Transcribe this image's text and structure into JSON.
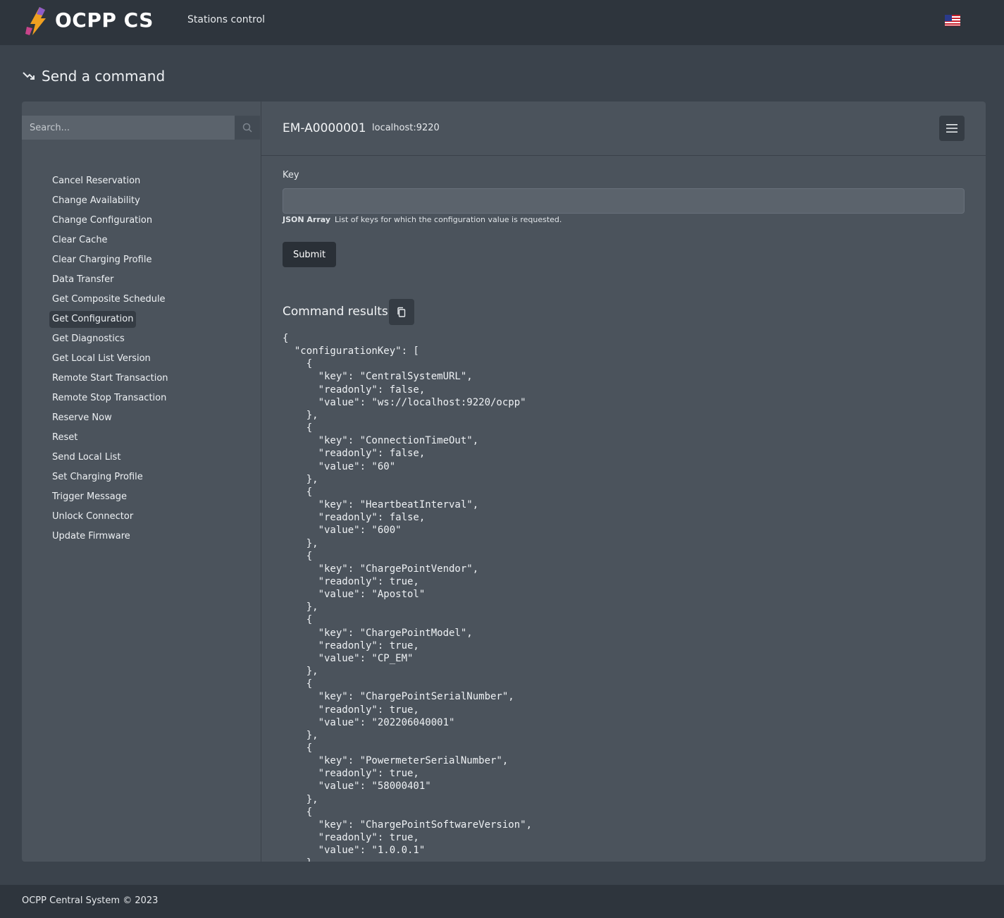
{
  "app": {
    "title": "OCPP CS",
    "nav_link": "Stations control"
  },
  "page": {
    "heading": "Send a command"
  },
  "sidebar": {
    "search_placeholder": "Search...",
    "commands": [
      {
        "label": "Cancel Reservation",
        "active": false
      },
      {
        "label": "Change Availability",
        "active": false
      },
      {
        "label": "Change Configuration",
        "active": false
      },
      {
        "label": "Clear Cache",
        "active": false
      },
      {
        "label": "Clear Charging Profile",
        "active": false
      },
      {
        "label": "Data Transfer",
        "active": false
      },
      {
        "label": "Get Composite Schedule",
        "active": false
      },
      {
        "label": "Get Configuration",
        "active": true
      },
      {
        "label": "Get Diagnostics",
        "active": false
      },
      {
        "label": "Get Local List Version",
        "active": false
      },
      {
        "label": "Remote Start Transaction",
        "active": false
      },
      {
        "label": "Remote Stop Transaction",
        "active": false
      },
      {
        "label": "Reserve Now",
        "active": false
      },
      {
        "label": "Reset",
        "active": false
      },
      {
        "label": "Send Local List",
        "active": false
      },
      {
        "label": "Set Charging Profile",
        "active": false
      },
      {
        "label": "Trigger Message",
        "active": false
      },
      {
        "label": "Unlock Connector",
        "active": false
      },
      {
        "label": "Update Firmware",
        "active": false
      }
    ]
  },
  "station": {
    "id": "EM-A0000001",
    "host": "localhost:9220"
  },
  "form": {
    "key_label": "Key",
    "key_value": "",
    "help_type": "JSON Array",
    "help_text": "List of keys for which the configuration value is requested.",
    "submit_label": "Submit"
  },
  "results": {
    "title": "Command results",
    "body": "{\n  \"configurationKey\": [\n    {\n      \"key\": \"CentralSystemURL\",\n      \"readonly\": false,\n      \"value\": \"ws://localhost:9220/ocpp\"\n    },\n    {\n      \"key\": \"ConnectionTimeOut\",\n      \"readonly\": false,\n      \"value\": \"60\"\n    },\n    {\n      \"key\": \"HeartbeatInterval\",\n      \"readonly\": false,\n      \"value\": \"600\"\n    },\n    {\n      \"key\": \"ChargePointVendor\",\n      \"readonly\": true,\n      \"value\": \"Apostol\"\n    },\n    {\n      \"key\": \"ChargePointModel\",\n      \"readonly\": true,\n      \"value\": \"CP_EM\"\n    },\n    {\n      \"key\": \"ChargePointSerialNumber\",\n      \"readonly\": true,\n      \"value\": \"202206040001\"\n    },\n    {\n      \"key\": \"PowermeterSerialNumber\",\n      \"readonly\": true,\n      \"value\": \"58000401\"\n    },\n    {\n      \"key\": \"ChargePointSoftwareVersion\",\n      \"readonly\": true,\n      \"value\": \"1.0.0.1\"\n    },"
  },
  "footer": {
    "text": "OCPP Central System © 2023"
  },
  "icons": {
    "logo": "lightning-plug-icon",
    "language": "us-flag-icon",
    "heading": "trending-down-icon",
    "search": "search-icon",
    "menu": "hamburger-menu-icon",
    "copy": "copy-icon"
  }
}
